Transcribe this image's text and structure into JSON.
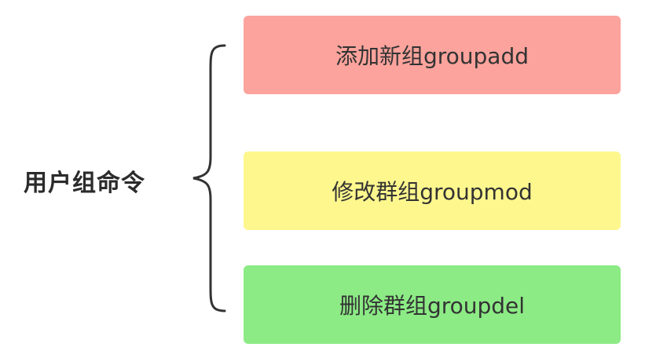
{
  "root": {
    "label": "用户组命令"
  },
  "nodes": [
    {
      "label": "添加新组groupadd",
      "color": "#fba39c"
    },
    {
      "label": "修改群组groupmod",
      "color": "#fdf78e"
    },
    {
      "label": "删除群组groupdel",
      "color": "#8ceb85"
    }
  ]
}
